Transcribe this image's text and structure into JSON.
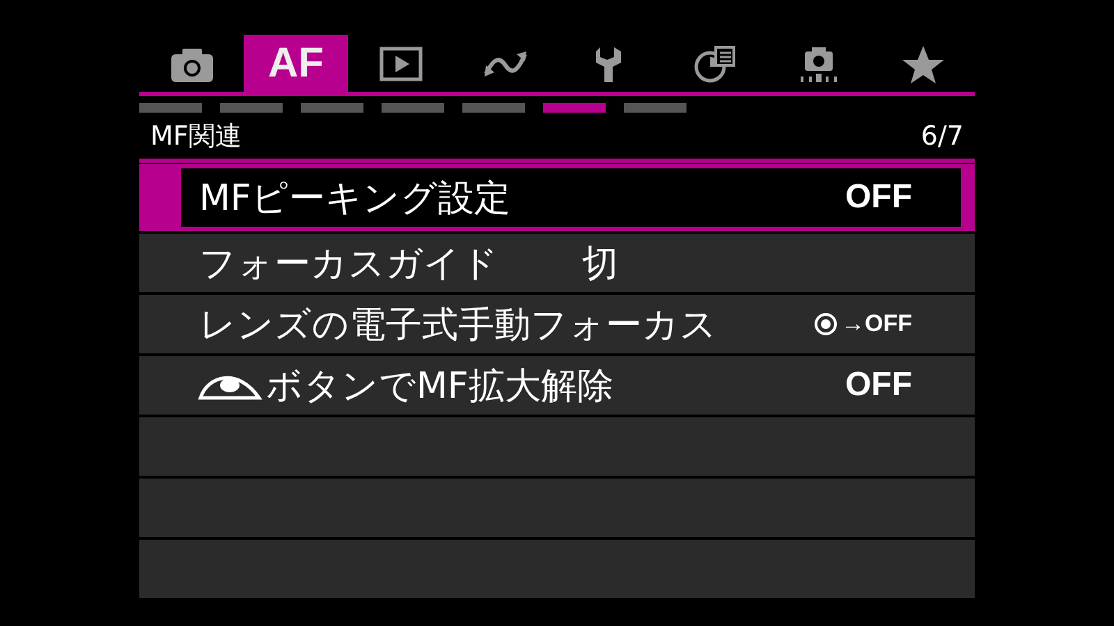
{
  "tabs": [
    {
      "kind": "camera",
      "selected": false
    },
    {
      "kind": "text",
      "label": "AF",
      "selected": true
    },
    {
      "kind": "play",
      "selected": false
    },
    {
      "kind": "wave",
      "selected": false
    },
    {
      "kind": "wrench",
      "selected": false
    },
    {
      "kind": "chart",
      "selected": false
    },
    {
      "kind": "camera-stand",
      "selected": false
    },
    {
      "kind": "star",
      "selected": false
    }
  ],
  "pages": [
    {
      "selected": false
    },
    {
      "selected": false
    },
    {
      "selected": false
    },
    {
      "selected": false
    },
    {
      "selected": false
    },
    {
      "selected": true
    },
    {
      "selected": false
    }
  ],
  "header": {
    "title": "MF関連",
    "page": "6/7"
  },
  "items": [
    {
      "kind": "setting",
      "label": "MFピーキング設定",
      "value": "OFF",
      "selected": true
    },
    {
      "kind": "inline",
      "label": "フォーカスガイド",
      "value": "切",
      "selected": false
    },
    {
      "kind": "dial",
      "label": "レンズの電子式手動フォーカス",
      "value": "→OFF",
      "selected": false
    },
    {
      "kind": "eye",
      "label": "ボタンでMF拡大解除",
      "value": "OFF",
      "selected": false
    }
  ]
}
